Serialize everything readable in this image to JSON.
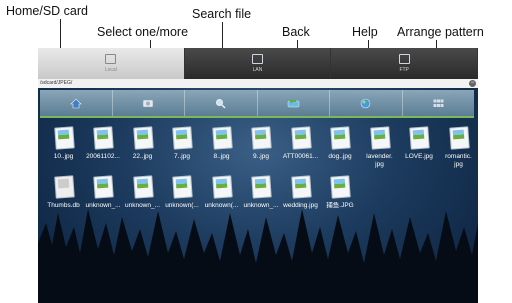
{
  "callouts": {
    "home": "Home/SD card",
    "select": "Select one/more",
    "search": "Search file",
    "back": "Back",
    "help": "Help",
    "arrange": "Arrange pattern"
  },
  "tabs": [
    {
      "label": "Local",
      "icon": "computer-icon",
      "active": true
    },
    {
      "label": "LAN",
      "icon": "network-icon",
      "active": false
    },
    {
      "label": "FTP",
      "icon": "server-icon",
      "active": false
    }
  ],
  "path": "/sdcard/JPEG/",
  "toolbar": [
    {
      "icon": "home-icon",
      "color": "#4a86c8"
    },
    {
      "icon": "select-icon",
      "color": "#d7dde3"
    },
    {
      "icon": "search-icon",
      "color": "#d7dde3"
    },
    {
      "icon": "back-icon",
      "color": "#6fbbe0"
    },
    {
      "icon": "help-icon",
      "color": "#4a9ad8"
    },
    {
      "icon": "arrange-icon",
      "color": "#c9d3dc"
    }
  ],
  "files_row1": [
    "10..jpg",
    "20061102...",
    "22..jpg",
    "7..jpg",
    "8..jpg",
    "9..jpg",
    "ATT00061...",
    "dog..jpg",
    "lavender.\njpg",
    "LOVE.jpg",
    "romantic.\njpg"
  ],
  "files_row2": [
    "Thumbs.db",
    "unknown_...",
    "unknown_...",
    "unknown(...",
    "unknown(...",
    "unknown_...",
    "wedding.jpg",
    "捕鱼.JPG"
  ]
}
